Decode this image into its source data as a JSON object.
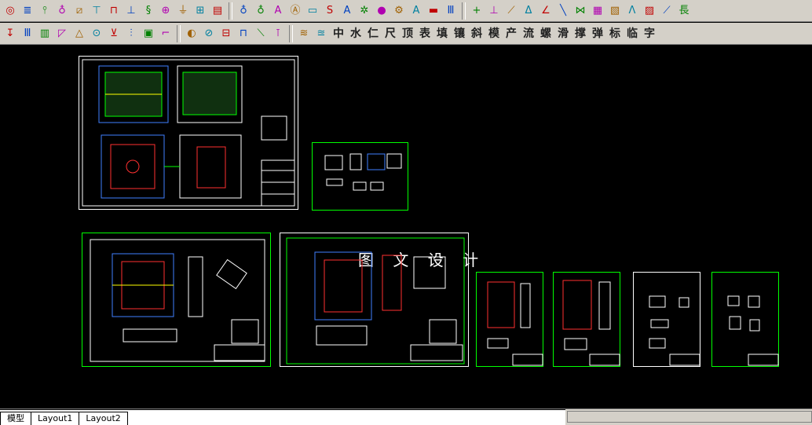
{
  "toolbar_row1": {
    "icons": [
      "ellipse-icon",
      "stack-icon",
      "drill-icon",
      "bulb-icon",
      "hatch-icon",
      "bolt-icon",
      "bracket-icon",
      "guide-pin-icon",
      "spring-icon",
      "target-icon",
      "funnel-icon",
      "mold-icon",
      "layer-icon",
      "bulb-icon",
      "bulb-icon",
      "a0-icon",
      "circle-text-icon",
      "folder-icon",
      "s9-icon",
      "a9-icon",
      "gear-icon",
      "yellow-circle-icon",
      "settings-icon",
      "a0-icon",
      "cup-icon",
      "bars-icon",
      "cross-icon",
      "dimension-icon",
      "slash-icon",
      "a-dim-icon",
      "angle-icon",
      "line-icon",
      "bridge-icon",
      "grid-icon",
      "line-color-icon",
      "lambda-icon",
      "hatch-lines-icon",
      "angle-line-icon",
      "long-label-icon"
    ],
    "last_label": "長"
  },
  "toolbar_row2": {
    "icons": [
      "insert-icon",
      "bars-icon",
      "ruler-icon",
      "chamfer-icon",
      "triangle-icon",
      "hole-icon",
      "nozzle-icon",
      "pin-icon",
      "block-icon",
      "stairs-icon",
      "dial-icon",
      "slash-circle-icon",
      "block2-icon",
      "rail-icon",
      "slash-rail-icon",
      "bolt2-icon",
      "layers-icon",
      "layers2-icon"
    ],
    "text_buttons": [
      "中",
      "水",
      "仁",
      "尺",
      "顶",
      "表",
      "填",
      "镶",
      "斜",
      "模",
      "产",
      "流",
      "螺",
      "滑",
      "撑",
      "弹",
      "标",
      "临",
      "字"
    ]
  },
  "watermark": "图 文 设 计",
  "layout_tabs": [
    "模型",
    "Layout1",
    "Layout2"
  ],
  "colors": {
    "sheet_border": "#00ff00",
    "sheet_border_white": "#ffffff",
    "drawing_red": "#ff3030",
    "drawing_blue": "#4080ff",
    "drawing_cyan": "#00e0ff",
    "drawing_yellow": "#ffff00",
    "drawing_white": "#ffffff",
    "drawing_green": "#00ff00"
  }
}
